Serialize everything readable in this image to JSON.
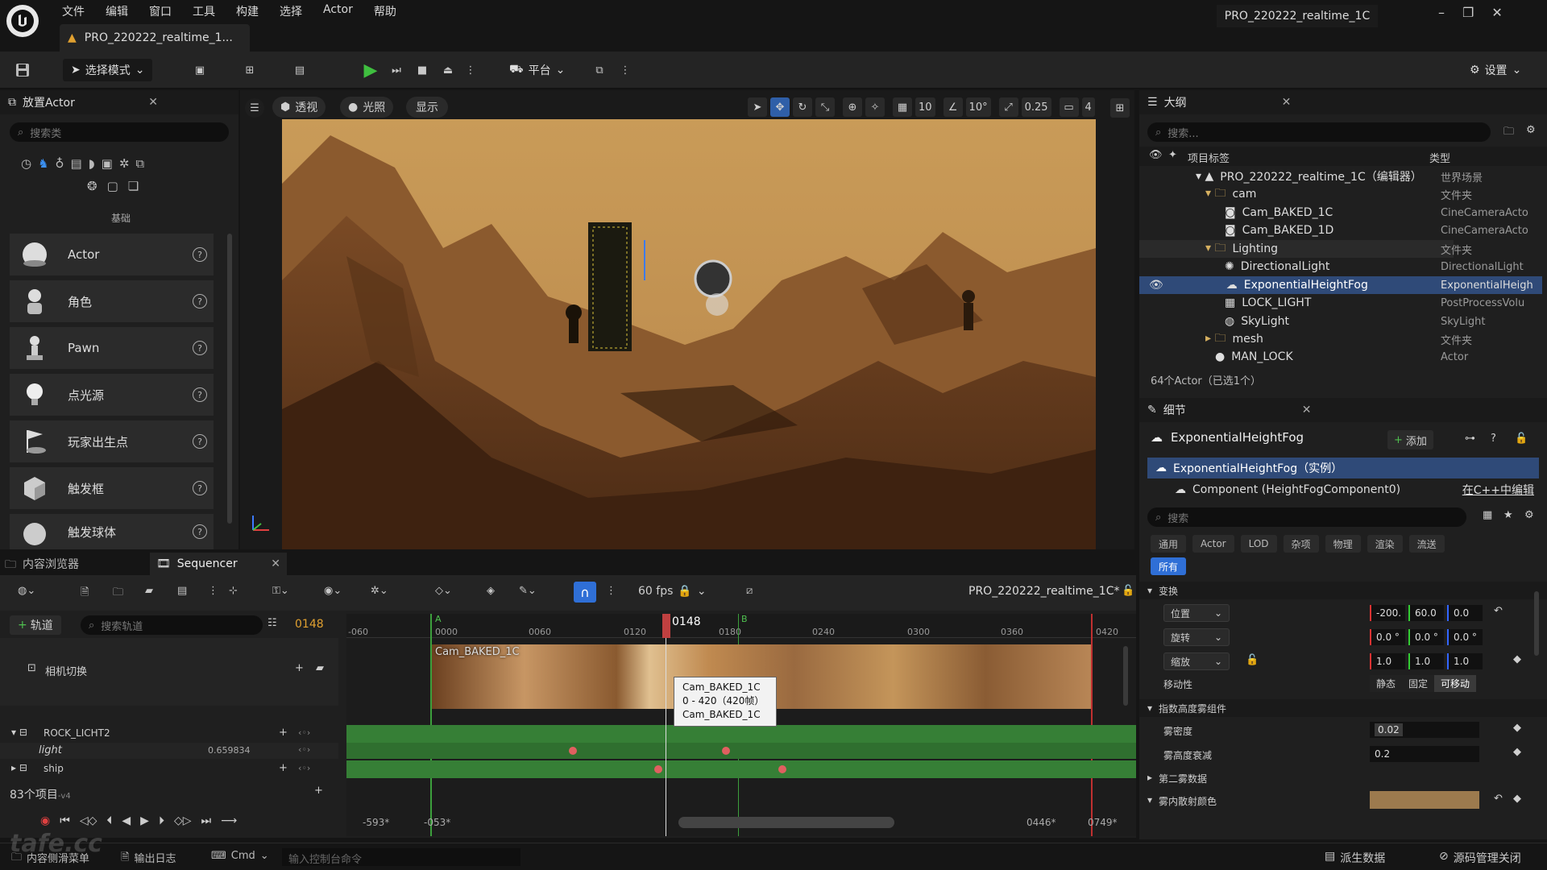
{
  "menu": [
    "文件",
    "编辑",
    "窗口",
    "工具",
    "构建",
    "选择",
    "Actor",
    "帮助"
  ],
  "window_title": "PRO_220222_realtime_1C",
  "doc_tab": "PRO_220222_realtime_1...",
  "toolbar": {
    "select_mode": "选择模式",
    "platform": "平台",
    "settings": "设置"
  },
  "place_actor": {
    "title": "放置Actor",
    "search_placeholder": "搜索类",
    "category": "基础",
    "items": [
      "Actor",
      "角色",
      "Pawn",
      "点光源",
      "玩家出生点",
      "触发框",
      "触发球体"
    ]
  },
  "viewport": {
    "perspective": "透视",
    "lighting": "光照",
    "show": "显示",
    "grid": "10",
    "angle": "10°",
    "scale": "0.25",
    "cam_speed": "4"
  },
  "outliner": {
    "title": "大纲",
    "search_placeholder": "搜索...",
    "col_label": "项目标签",
    "col_type": "类型",
    "rows": [
      {
        "label": "PRO_220222_realtime_1C（编辑器）",
        "type": "世界场景"
      },
      {
        "label": "cam",
        "type": "文件夹"
      },
      {
        "label": "Cam_BAKED_1C",
        "type": "CineCameraActo"
      },
      {
        "label": "Cam_BAKED_1D",
        "type": "CineCameraActo"
      },
      {
        "label": "Lighting",
        "type": "文件夹"
      },
      {
        "label": "DirectionalLight",
        "type": "DirectionalLight"
      },
      {
        "label": "ExponentialHeightFog",
        "type": "ExponentialHeigh"
      },
      {
        "label": "LOCK_LIGHT",
        "type": "PostProcessVolu"
      },
      {
        "label": "SkyLight",
        "type": "SkyLight"
      },
      {
        "label": "mesh",
        "type": "文件夹"
      },
      {
        "label": "MAN_LOCK",
        "type": "Actor"
      }
    ],
    "footer": "64个Actor（已选1个）"
  },
  "details": {
    "title": "细节",
    "actor_name": "ExponentialHeightFog",
    "add": "添加",
    "instance": "ExponentialHeightFog（实例）",
    "component": "Component (HeightFogComponent0)",
    "cpp_link": "在C++中编辑",
    "search_placeholder": "搜索",
    "filter_tabs": [
      "通用",
      "Actor",
      "LOD",
      "杂项",
      "物理",
      "渲染",
      "流送"
    ],
    "all": "所有",
    "transform": "变换",
    "location": "位置",
    "rotation": "旋转",
    "scale": "缩放",
    "loc_vals": [
      "-200.",
      "60.0",
      "0.0"
    ],
    "rot_vals": [
      "0.0 °",
      "0.0 °",
      "0.0 °"
    ],
    "scale_vals": [
      "1.0",
      "1.0",
      "1.0"
    ],
    "mobility": "移动性",
    "mob_static": "静态",
    "mob_stationary": "固定",
    "mob_movable": "可移动",
    "fog_section": "指数高度雾组件",
    "fog_density_label": "雾密度",
    "fog_density": "0.02",
    "fog_falloff_label": "雾高度衰减",
    "fog_falloff": "0.2",
    "second_fog": "第二雾数据",
    "inscatter": "雾内散射颜色"
  },
  "sequencer": {
    "content_browser_tab": "内容浏览器",
    "tab": "Sequencer",
    "fps": "60 fps",
    "sequence_name": "PRO_220222_realtime_1C*",
    "add_track": "轨道",
    "search_placeholder": "搜索轨道",
    "current_frame": "0148",
    "ruler_ticks": [
      "-060",
      "0000",
      "0060",
      "0120",
      "0180",
      "0240",
      "0300",
      "0360",
      "0420"
    ],
    "marker_a": "A",
    "marker_b": "B",
    "tracks": {
      "camera_cut": "相机切换",
      "rock": "ROCK_LICHT2",
      "light": "light",
      "light_val": "0.659834",
      "ship": "ship"
    },
    "shot_label": "Cam_BAKED_1C",
    "tooltip": [
      "Cam_BAKED_1C",
      "0 - 420（420帧）",
      "Cam_BAKED_1C"
    ],
    "item_count": "83个项目",
    "item_count_suffix": "-v4",
    "range": [
      "-593*",
      "-053*",
      "0446*",
      "0749*"
    ]
  },
  "statusbar": {
    "content_drawer": "内容侧滑菜单",
    "output_log": "输出日志",
    "cmd": "Cmd",
    "console_placeholder": "输入控制台命令",
    "derived_data": "派生数据",
    "source_control": "源码管理关闭"
  },
  "watermark": "tafe.cc"
}
